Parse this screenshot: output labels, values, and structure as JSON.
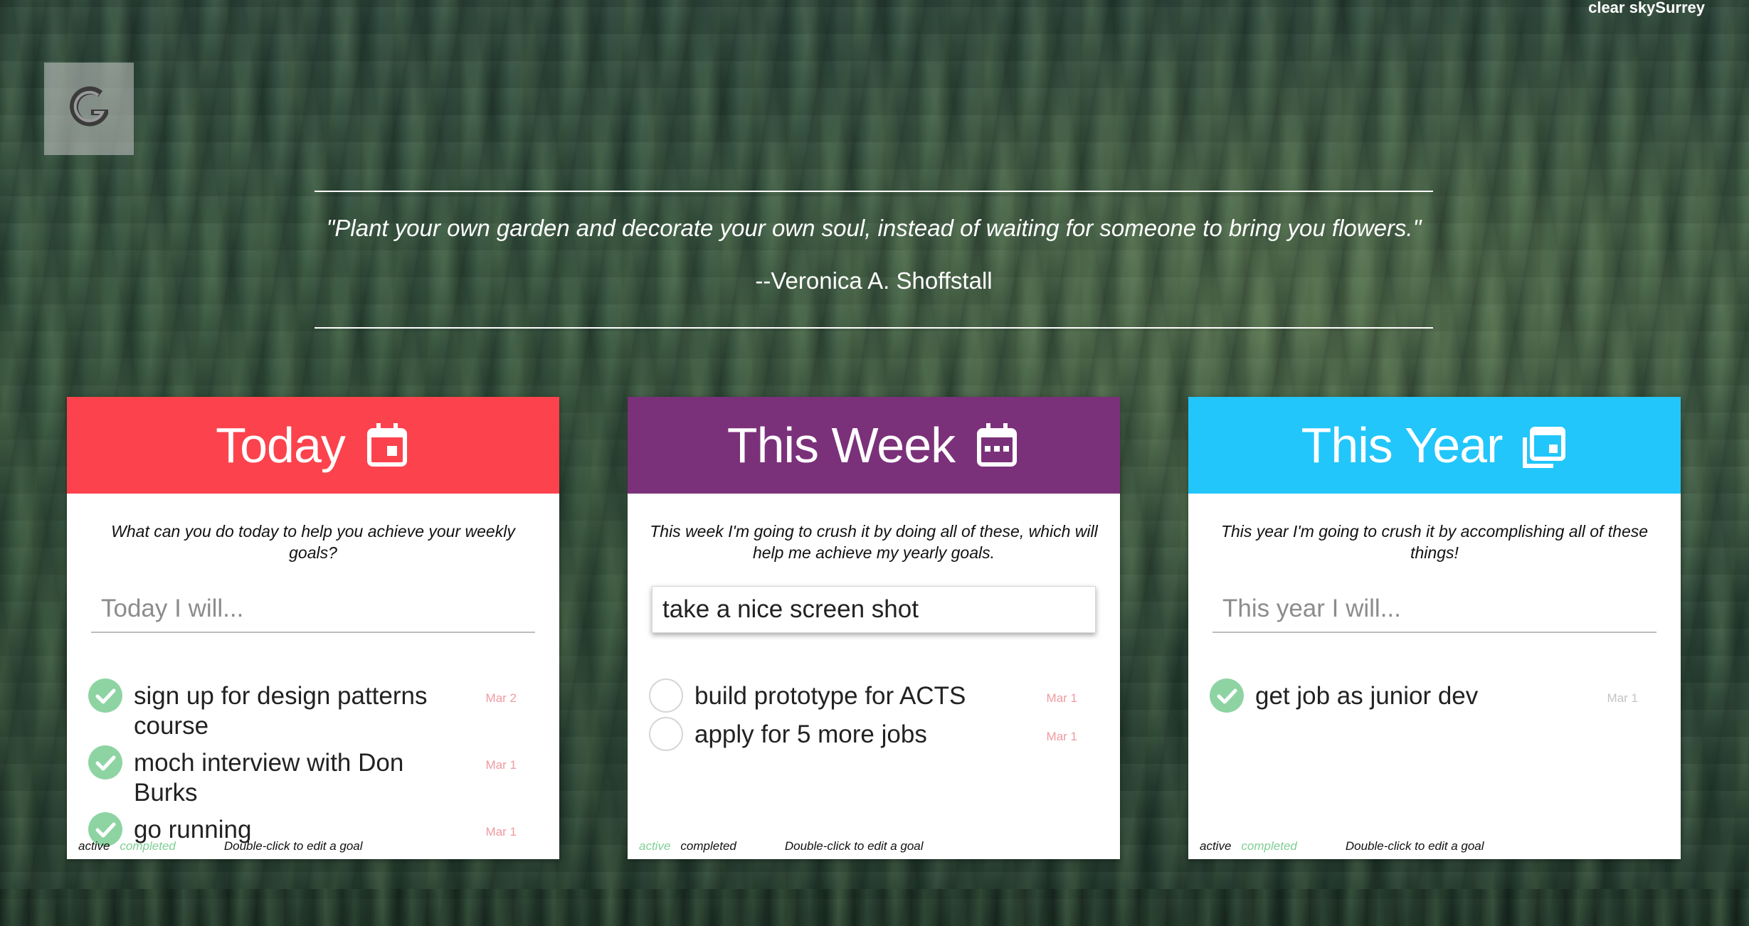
{
  "weather": {
    "label": "clear skySurrey"
  },
  "quote": {
    "text": "\"Plant your own garden and decorate your own soul, instead of waiting for someone to bring you flowers.\"",
    "author": "--Veronica A. Shoffstall"
  },
  "colors": {
    "today": "#fc434d",
    "week": "#7b317a",
    "year": "#22c6fa",
    "done": "#8ed4a3",
    "date": "#f09aa0"
  },
  "cards": [
    {
      "title": "Today",
      "icon": "calendar-day-icon",
      "description": "What can you do today to help you achieve your weekly goals?",
      "input_value": "",
      "input_placeholder": "Today I will...",
      "goals": [
        {
          "text": "sign up for design patterns course",
          "date": "Mar 2",
          "done": true
        },
        {
          "text": "moch interview with Don Burks",
          "date": "Mar 1",
          "done": true
        },
        {
          "text": "go running",
          "date": "Mar 1",
          "done": true
        }
      ],
      "footer": {
        "active": "active",
        "completed": "completed",
        "hint": "Double-click to edit a goal",
        "selected": "completed"
      }
    },
    {
      "title": "This Week",
      "icon": "calendar-week-icon",
      "description": "This week I'm going to crush it by doing all of these, which will help me achieve my yearly goals.",
      "input_value": "take a nice screen shot",
      "input_placeholder": "",
      "goals": [
        {
          "text": "build prototype for ACTS",
          "date": "Mar 1",
          "done": false
        },
        {
          "text": "apply for 5 more jobs",
          "date": "Mar 1",
          "done": false
        }
      ],
      "footer": {
        "active": "active",
        "completed": "completed",
        "hint": "Double-click to edit a goal",
        "selected": "active"
      }
    },
    {
      "title": "This Year",
      "icon": "calendar-stack-icon",
      "description": "This year I'm going to crush it by accomplishing all of these things!",
      "input_value": "",
      "input_placeholder": "This year I will...",
      "goals": [
        {
          "text": "get job as junior dev",
          "date": "Mar 1",
          "done": true
        }
      ],
      "footer": {
        "active": "active",
        "completed": "completed",
        "hint": "Double-click to edit a goal",
        "selected": "completed"
      }
    }
  ]
}
